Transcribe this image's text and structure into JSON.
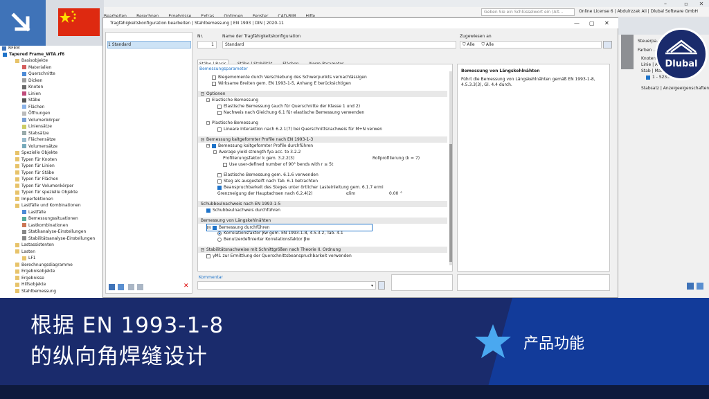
{
  "app": {
    "menu": [
      "Bearbeiten",
      "Berechnen",
      "Ergebnisse",
      "Extras",
      "Optionen",
      "Fenster",
      "CAD-BIM",
      "Hilfe"
    ],
    "search_placeholder": "Geben Sie ein Schlüsselwort ein (Alt...",
    "license": "Online License 6 | Abdulrzzak Ali | Dlubal Software GmbH"
  },
  "nav": {
    "root": "RFEM",
    "project": "Tapered Frame_WTA.rf6",
    "items": [
      "Basisobjekte",
      "Materialien",
      "Querschnitte",
      "Dicken",
      "Knoten",
      "Linien",
      "Stäbe",
      "Flächen",
      "Öffnungen",
      "Volumenkörper",
      "Liniensätze",
      "Stabsätze",
      "Flächensätze",
      "Volumensätze",
      "Spezielle Objekte",
      "Typen für Knoten",
      "Typen für Linien",
      "Typen für Stäbe",
      "Typen für Flächen",
      "Typen für Volumenkörper",
      "Typen für spezielle Objekte",
      "Imperfektionen",
      "Lastfälle und Kombinationen",
      "Lastfälle",
      "Bemessungssituationen",
      "Lastkombinationen",
      "Statikanalyse-Einstellungen",
      "Stabilitätsanalyse-Einstellungen",
      "Lastassistenten",
      "Lasten",
      "LF1",
      "Berechnungsdiagramme",
      "Ergebnisobjekte",
      "Ergebnisse",
      "Hilfsobjekte",
      "Stahlbemessung"
    ]
  },
  "dialog": {
    "title": "Tragfähigkeitskonfiguration bearbeiten | Stahlbemessung | EN 1993 | DIN | 2020-11",
    "list_item": "1  Standard",
    "no_label": "Nr.",
    "no_value": "1",
    "name_label": "Name der Tragfähigkeitskonfiguration",
    "name_value": "Standard",
    "assigned_label": "Zugewiesen an",
    "assigned_all1": "Alle",
    "assigned_all2": "Alle",
    "tabs": [
      "Stäbe | Basis",
      "Stäbe | Stabilität",
      "Flächen",
      "Norm-Parameter"
    ],
    "params_header": "Bemessungsparameter",
    "comment_label": "Kommentar",
    "info_title": "Bemessung von Längskehlnähten",
    "info_text": "Führt die Bemessung von Längskehlnähten gemäß EN 1993-1-8, 4.5.3.3(3), Gl. 4.4 durch.",
    "rows": {
      "r0": "Biegemomente durch Verschiebung des Schwerpunkts vernachlässigen",
      "r1": "Wirksame Breiten gem. EN 1993-1-5, Anhang E berücksichtigen",
      "optionen": "Optionen",
      "elastische": "Elastische Bemessung",
      "e1": "Elastische Bemessung (auch für Querschnitte der Klasse 1 und 2)",
      "e2": "Nachweis nach Gleichung 6.1 für elastische Bemessung verwenden",
      "plastische": "Plastische Bemessung",
      "p1": "Lineare Interaktion nach 6.2.1(7) bei Querschnittsnachweis für M+N verwen",
      "kaltgeformt": "Bemessung kaltgeformter Profile nach EN 1993-1-3",
      "k1": "Bemessung kaltgeformter Profile durchführen",
      "k2": "Average yield strength fya acc. to 3.2.2",
      "k3": "Profilierungsfaktor k gem. 3.2.2(3)",
      "k3v": "Rollprofilierung (k = 7)",
      "k4": "Use user-defined number of 90° bends with r ≤ 5t",
      "k5": "Elastische Bemessung gem. 6.1.6 verwenden",
      "k6": "Steg als ausgesteift nach Tab. 6.1 betrachten",
      "k7": "Beanspruchbarkeit des Steges unter örtlicher Lasteinleitung gem. 6.1.7 ermi",
      "k8": "Grenzneigung der Hauptachsen nach 6.2.4(2)",
      "k8u": "αlim",
      "k8v": "0.00",
      "k8d": "°",
      "schub": "Schubbeulnachweis nach EN 1993-1-5",
      "s1": "Schubbeulnachweis durchführen",
      "laengs": "Bemessung von Längskehlnähten",
      "l1": "Bemessung durchführen",
      "l2": "Korrelationsfaktor βw gem. EN 1993-1-8, 4.5.3.2, Tab. 4.1",
      "l3": "Benutzerdefinierter Korrelationsfaktor βw",
      "stab": "Stabilitätsnachweise mit Schnittgrößen nach Theorie II. Ordnung",
      "st1": "γM1 zur Ermittlung der Querschnittsbeanspruchbarkeit verwenden"
    }
  },
  "right": {
    "title": "Steuerpa...",
    "farben": "Farben ...",
    "knoten": "Knoten",
    "linie": "Linie | A...",
    "stab": "Stab | Ma...",
    "item": "1 - S235",
    "footer": "Stabsatz | Anzeigeeigenschaften"
  },
  "banner": {
    "line1": "根据 EN 1993-1-8",
    "line2": "的纵向角焊缝设计",
    "product": "产品功能",
    "brand": "Dlubal"
  },
  "colors": {
    "banner": "#1a2b6c",
    "accent": "#1e73c9",
    "flag": "#de2910"
  }
}
